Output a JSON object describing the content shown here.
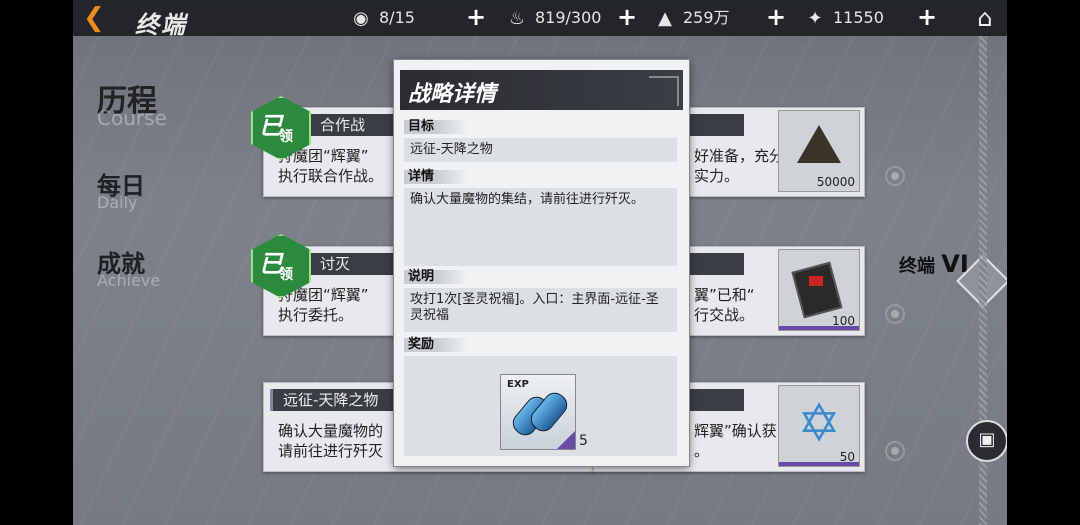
{
  "topbar": {
    "title": "终端",
    "resources": [
      {
        "icon": "eye-icon",
        "value": "8/15"
      },
      {
        "icon": "flame-icon",
        "value": "819/300"
      },
      {
        "icon": "triangle-crest-icon",
        "value": "259万"
      },
      {
        "icon": "star-crest-icon",
        "value": "11550"
      }
    ]
  },
  "sidebar": {
    "items": [
      {
        "zh": "历程",
        "en": "Course"
      },
      {
        "zh": "每日",
        "en": "Daily"
      },
      {
        "zh": "成就",
        "en": "Achieve"
      }
    ]
  },
  "cards": [
    {
      "header": "合作战",
      "line1": "狩魔团“辉翼”",
      "line2": "执行联合作战。",
      "badge": {
        "main": "已",
        "sub": "领"
      }
    },
    {
      "header": "讨灭",
      "line1": "狩魔团“辉翼”",
      "line2": "执行委托。",
      "badge": {
        "main": "已",
        "sub": "领"
      }
    },
    {
      "header": "远征-天降之物",
      "line1": "确认大量魔物的",
      "line2": "请前往进行歼灭"
    }
  ],
  "right_cards": [
    {
      "line1": "好准备，充分",
      "line2": "实力。",
      "item_count": "50000"
    },
    {
      "line1": "翼”已和“",
      "line2": "行交战。",
      "item_count": "100"
    },
    {
      "line1": "辉翼”确认获",
      "line2": "。",
      "item_count": "50"
    }
  ],
  "tier": {
    "label": "终端",
    "numeral": "VI"
  },
  "modal": {
    "title": "战略详情",
    "sections": {
      "goal_label": "目标",
      "goal_text": "远征-天降之物",
      "detail_label": "详情",
      "detail_text": "确认大量魔物的集结，请前往进行歼灭。",
      "note_label": "说明",
      "note_text": "攻打1次[圣灵祝福]。入口：主界面-远征-圣灵祝福",
      "reward_label": "奖励"
    },
    "reward": {
      "tag": "EXP",
      "count": "5"
    }
  }
}
